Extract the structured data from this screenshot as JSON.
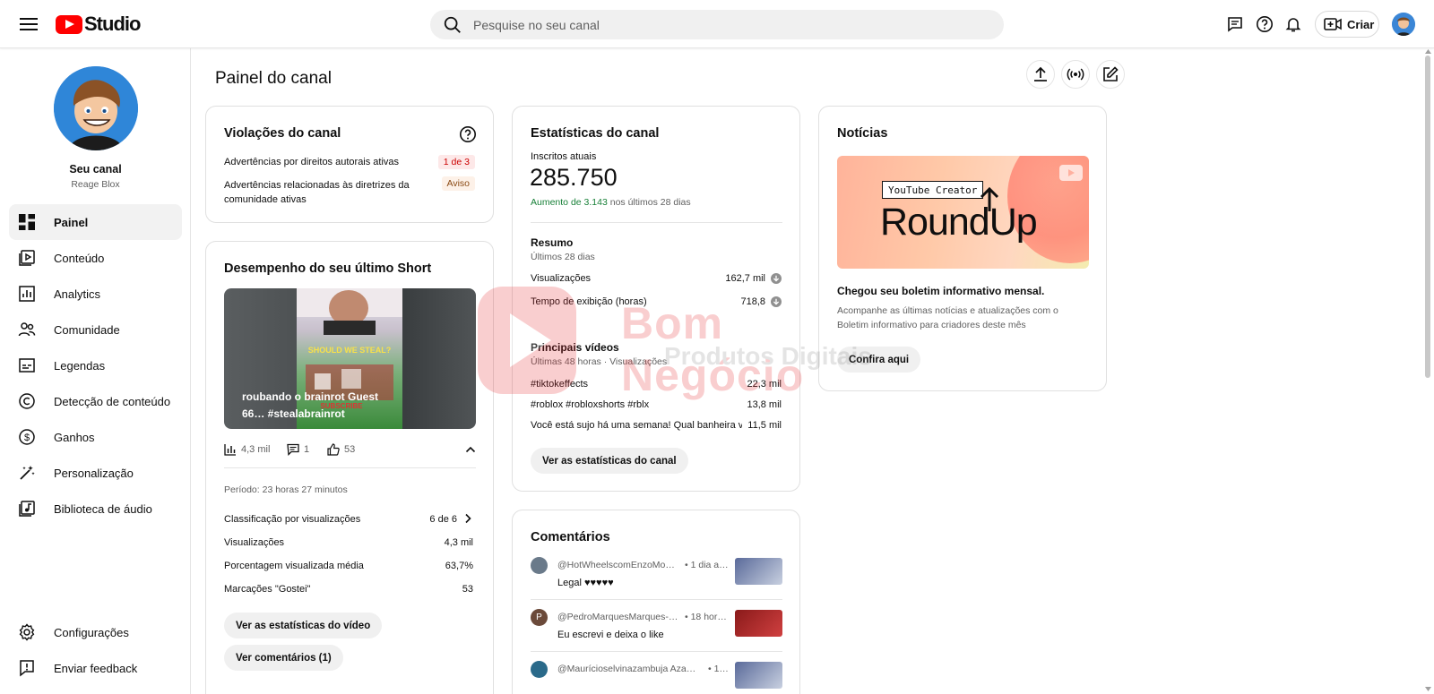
{
  "header": {
    "logo_text": "Studio",
    "search_placeholder": "Pesquise no seu canal",
    "create_label": "Criar"
  },
  "sidebar": {
    "channel_title": "Seu canal",
    "channel_handle": "Reage Blox",
    "items": [
      {
        "label": "Painel",
        "icon": "dashboard-icon",
        "active": true
      },
      {
        "label": "Conteúdo",
        "icon": "content-icon"
      },
      {
        "label": "Analytics",
        "icon": "analytics-icon"
      },
      {
        "label": "Comunidade",
        "icon": "community-icon"
      },
      {
        "label": "Legendas",
        "icon": "subtitles-icon"
      },
      {
        "label": "Detecção de conteúdo",
        "icon": "copyright-icon"
      },
      {
        "label": "Ganhos",
        "icon": "earn-icon"
      },
      {
        "label": "Personalização",
        "icon": "customization-icon"
      },
      {
        "label": "Biblioteca de áudio",
        "icon": "audio-library-icon"
      }
    ],
    "bottom_items": [
      {
        "label": "Configurações",
        "icon": "settings-icon"
      },
      {
        "label": "Enviar feedback",
        "icon": "feedback-icon"
      }
    ]
  },
  "main": {
    "page_title": "Painel do canal"
  },
  "violations": {
    "title": "Violações do canal",
    "rows": [
      {
        "label": "Advertências por direitos autorais ativas",
        "badge": "1 de 3"
      },
      {
        "label": "Advertências relacionadas às diretrizes da comunidade ativas",
        "badge": "Aviso"
      }
    ]
  },
  "short": {
    "title": "Desempenho do seu último Short",
    "caption": "roubando o brainrot Guest 66… #stealabrainrot",
    "views": "4,3 mil",
    "comments": "1",
    "likes": "53",
    "period": "Período: 23 horas 27 minutos",
    "rows": [
      {
        "label": "Classificação por visualizações",
        "value": "6 de 6"
      },
      {
        "label": "Visualizações",
        "value": "4,3 mil"
      },
      {
        "label": "Porcentagem visualizada média",
        "value": "63,7%"
      },
      {
        "label": "Marcações \"Gostei\"",
        "value": "53"
      }
    ],
    "btn_stats": "Ver as estatísticas do vídeo",
    "btn_comments": "Ver comentários (1)"
  },
  "stats": {
    "title": "Estatísticas do canal",
    "subs_label": "Inscritos atuais",
    "subs_value": "285.750",
    "growth_highlight": "Aumento de 3.143",
    "growth_rest": "nos últimos 28 dias",
    "summary_title": "Resumo",
    "summary_period": "Últimos 28 dias",
    "summary_rows": [
      {
        "label": "Visualizações",
        "value": "162,7 mil"
      },
      {
        "label": "Tempo de exibição (horas)",
        "value": "718,8"
      }
    ],
    "top_title": "Principais vídeos",
    "top_period": "Últimas 48 horas · Visualizações",
    "top_rows": [
      {
        "label": "#tiktokeffects",
        "value": "22,3 mil"
      },
      {
        "label": "#roblox #robloxshorts #rblx",
        "value": "13,8 mil"
      },
      {
        "label": "Você está sujo há uma semana! Qual banheira v…",
        "value": "11,5 mil"
      }
    ],
    "btn": "Ver as estatísticas do canal"
  },
  "news": {
    "title": "Notícias",
    "banner_tag": "YouTube Creator",
    "banner_title": "RoundUp",
    "headline": "Chegou seu boletim informativo mensal.",
    "body": "Acompanhe as últimas notícias e atualizações com o Boletim informativo para criadores deste mês",
    "btn": "Confira aqui"
  },
  "comments": {
    "title": "Comentários",
    "items": [
      {
        "author": "@HotWheelscomEnzoMo…",
        "time": "• 1 dia a…",
        "text": "Legal ♥♥♥♥♥"
      },
      {
        "author": "@PedroMarquesMarques-…",
        "time": "• 18 hor…",
        "text": "Eu escrevi e deixa o like"
      },
      {
        "author": "@Maurícioselvinazambuja Aza…",
        "time": "• 1…",
        "text": ""
      }
    ]
  },
  "watermark": {
    "line1": "Bom Negócio",
    "line2": "Produtos Digitais"
  },
  "colors": {
    "brand_red": "#ff0000",
    "growth_green": "#188038",
    "badge_red": "#cc0000"
  }
}
